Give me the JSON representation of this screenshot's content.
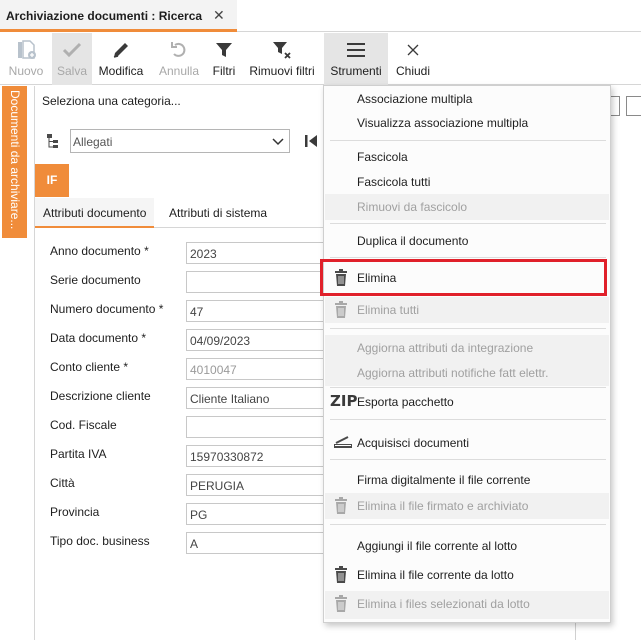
{
  "tab": {
    "title": "Archiviazione documenti : Ricerca",
    "close_glyph": "✕",
    "accent": "#f08c3a"
  },
  "toolbar": {
    "buttons": [
      {
        "label": "Nuovo",
        "icon": "new-document-icon",
        "enabled": false
      },
      {
        "label": "Salva",
        "icon": "checkmark-icon",
        "enabled": false
      },
      {
        "label": "Modifica",
        "icon": "pencil-icon",
        "enabled": true
      },
      {
        "label": "Annulla",
        "icon": "undo-icon",
        "enabled": false
      },
      {
        "label": "Filtri",
        "icon": "filter-icon",
        "enabled": true
      },
      {
        "label": "Rimuovi filtri",
        "icon": "remove-filter-icon",
        "enabled": true
      },
      {
        "label": "Strumenti",
        "icon": "hamburger-menu-icon",
        "enabled": true,
        "pressed": true
      },
      {
        "label": "Chiudi",
        "icon": "close-icon",
        "enabled": true
      }
    ]
  },
  "sidebar": {
    "vertical_tab": "Documenti da archiviare..."
  },
  "category": {
    "label": "Seleziona una categoria...",
    "selected": "Allegati"
  },
  "badge": "IF",
  "subtabs": [
    "Attributi documento",
    "Attributi di sistema"
  ],
  "form": {
    "fields": [
      {
        "label": "Anno documento *",
        "value": "2023",
        "readonly": false
      },
      {
        "label": "Serie documento",
        "value": "",
        "readonly": false
      },
      {
        "label": "Numero documento *",
        "value": "47",
        "readonly": false
      },
      {
        "label": "Data documento *",
        "value": "04/09/2023",
        "readonly": false
      },
      {
        "label": "Conto cliente *",
        "value": "4010047",
        "readonly": true
      },
      {
        "label": "Descrizione cliente",
        "value": "Cliente Italiano",
        "readonly": false
      },
      {
        "label": "Cod. Fiscale",
        "value": "",
        "readonly": false
      },
      {
        "label": "Partita IVA",
        "value": "15970330872",
        "readonly": false
      },
      {
        "label": "Città",
        "value": "PERUGIA",
        "readonly": false
      },
      {
        "label": "Provincia",
        "value": "PG",
        "readonly": false
      },
      {
        "label": "Tipo doc. business",
        "value": "A",
        "readonly": false
      }
    ]
  },
  "menu": {
    "items": [
      {
        "label": "Associazione multipla",
        "enabled": true,
        "icon": ""
      },
      {
        "label": "Visualizza associazione multipla",
        "enabled": true,
        "icon": ""
      },
      {
        "label": "Fascicola",
        "enabled": true,
        "icon": ""
      },
      {
        "label": "Fascicola tutti",
        "enabled": true,
        "icon": ""
      },
      {
        "label": "Rimuovi da fascicolo",
        "enabled": false,
        "icon": ""
      },
      {
        "label": "Duplica il documento",
        "enabled": true,
        "icon": ""
      },
      {
        "label": "Elimina",
        "enabled": true,
        "icon": "trash-icon",
        "highlighted": true
      },
      {
        "label": "Elimina tutti",
        "enabled": false,
        "icon": "trash-icon"
      },
      {
        "label": "Aggiorna attributi da integrazione",
        "enabled": false,
        "icon": ""
      },
      {
        "label": "Aggiorna attributi notifiche fatt elettr.",
        "enabled": false,
        "icon": ""
      },
      {
        "label": "Esporta pacchetto",
        "enabled": true,
        "icon": "zip-icon",
        "icon_text": "ZIP"
      },
      {
        "label": "Acquisisci documenti",
        "enabled": true,
        "icon": "scanner-icon"
      },
      {
        "label": "Firma digitalmente il file corrente",
        "enabled": true,
        "icon": ""
      },
      {
        "label": "Elimina il file firmato e archiviato",
        "enabled": false,
        "icon": "trash-icon"
      },
      {
        "label": "Aggiungi il file corrente al lotto",
        "enabled": true,
        "icon": ""
      },
      {
        "label": "Elimina il file corrente da lotto",
        "enabled": true,
        "icon": "trash-icon"
      },
      {
        "label": "Elimina i files selezionati da lotto",
        "enabled": false,
        "icon": "trash-icon"
      }
    ],
    "highlight_color": "#e0202a"
  }
}
